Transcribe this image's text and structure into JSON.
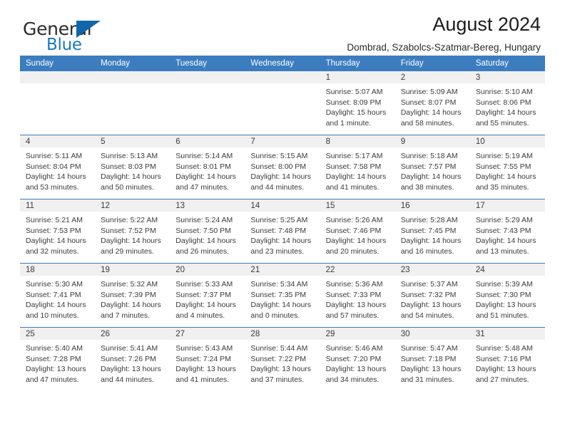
{
  "brand": {
    "name_top": "General",
    "name_bottom": "Blue",
    "logo_icon": "triangle-logo-icon",
    "accent_color": "#1878be"
  },
  "header": {
    "title": "August 2024",
    "location": "Dombrad, Szabolcs-Szatmar-Bereg, Hungary"
  },
  "colors": {
    "header_blue": "#3b7dbf",
    "daynum_band": "#f0f0f0",
    "text": "#3b3b3b"
  },
  "weekday_headers": [
    "Sunday",
    "Monday",
    "Tuesday",
    "Wednesday",
    "Thursday",
    "Friday",
    "Saturday"
  ],
  "weeks": [
    [
      {
        "day": "",
        "lines": []
      },
      {
        "day": "",
        "lines": []
      },
      {
        "day": "",
        "lines": []
      },
      {
        "day": "",
        "lines": []
      },
      {
        "day": "1",
        "lines": [
          "Sunrise: 5:07 AM",
          "Sunset: 8:09 PM",
          "Daylight: 15 hours",
          "and 1 minute."
        ]
      },
      {
        "day": "2",
        "lines": [
          "Sunrise: 5:09 AM",
          "Sunset: 8:07 PM",
          "Daylight: 14 hours",
          "and 58 minutes."
        ]
      },
      {
        "day": "3",
        "lines": [
          "Sunrise: 5:10 AM",
          "Sunset: 8:06 PM",
          "Daylight: 14 hours",
          "and 55 minutes."
        ]
      }
    ],
    [
      {
        "day": "4",
        "lines": [
          "Sunrise: 5:11 AM",
          "Sunset: 8:04 PM",
          "Daylight: 14 hours",
          "and 53 minutes."
        ]
      },
      {
        "day": "5",
        "lines": [
          "Sunrise: 5:13 AM",
          "Sunset: 8:03 PM",
          "Daylight: 14 hours",
          "and 50 minutes."
        ]
      },
      {
        "day": "6",
        "lines": [
          "Sunrise: 5:14 AM",
          "Sunset: 8:01 PM",
          "Daylight: 14 hours",
          "and 47 minutes."
        ]
      },
      {
        "day": "7",
        "lines": [
          "Sunrise: 5:15 AM",
          "Sunset: 8:00 PM",
          "Daylight: 14 hours",
          "and 44 minutes."
        ]
      },
      {
        "day": "8",
        "lines": [
          "Sunrise: 5:17 AM",
          "Sunset: 7:58 PM",
          "Daylight: 14 hours",
          "and 41 minutes."
        ]
      },
      {
        "day": "9",
        "lines": [
          "Sunrise: 5:18 AM",
          "Sunset: 7:57 PM",
          "Daylight: 14 hours",
          "and 38 minutes."
        ]
      },
      {
        "day": "10",
        "lines": [
          "Sunrise: 5:19 AM",
          "Sunset: 7:55 PM",
          "Daylight: 14 hours",
          "and 35 minutes."
        ]
      }
    ],
    [
      {
        "day": "11",
        "lines": [
          "Sunrise: 5:21 AM",
          "Sunset: 7:53 PM",
          "Daylight: 14 hours",
          "and 32 minutes."
        ]
      },
      {
        "day": "12",
        "lines": [
          "Sunrise: 5:22 AM",
          "Sunset: 7:52 PM",
          "Daylight: 14 hours",
          "and 29 minutes."
        ]
      },
      {
        "day": "13",
        "lines": [
          "Sunrise: 5:24 AM",
          "Sunset: 7:50 PM",
          "Daylight: 14 hours",
          "and 26 minutes."
        ]
      },
      {
        "day": "14",
        "lines": [
          "Sunrise: 5:25 AM",
          "Sunset: 7:48 PM",
          "Daylight: 14 hours",
          "and 23 minutes."
        ]
      },
      {
        "day": "15",
        "lines": [
          "Sunrise: 5:26 AM",
          "Sunset: 7:46 PM",
          "Daylight: 14 hours",
          "and 20 minutes."
        ]
      },
      {
        "day": "16",
        "lines": [
          "Sunrise: 5:28 AM",
          "Sunset: 7:45 PM",
          "Daylight: 14 hours",
          "and 16 minutes."
        ]
      },
      {
        "day": "17",
        "lines": [
          "Sunrise: 5:29 AM",
          "Sunset: 7:43 PM",
          "Daylight: 14 hours",
          "and 13 minutes."
        ]
      }
    ],
    [
      {
        "day": "18",
        "lines": [
          "Sunrise: 5:30 AM",
          "Sunset: 7:41 PM",
          "Daylight: 14 hours",
          "and 10 minutes."
        ]
      },
      {
        "day": "19",
        "lines": [
          "Sunrise: 5:32 AM",
          "Sunset: 7:39 PM",
          "Daylight: 14 hours",
          "and 7 minutes."
        ]
      },
      {
        "day": "20",
        "lines": [
          "Sunrise: 5:33 AM",
          "Sunset: 7:37 PM",
          "Daylight: 14 hours",
          "and 4 minutes."
        ]
      },
      {
        "day": "21",
        "lines": [
          "Sunrise: 5:34 AM",
          "Sunset: 7:35 PM",
          "Daylight: 14 hours",
          "and 0 minutes."
        ]
      },
      {
        "day": "22",
        "lines": [
          "Sunrise: 5:36 AM",
          "Sunset: 7:33 PM",
          "Daylight: 13 hours",
          "and 57 minutes."
        ]
      },
      {
        "day": "23",
        "lines": [
          "Sunrise: 5:37 AM",
          "Sunset: 7:32 PM",
          "Daylight: 13 hours",
          "and 54 minutes."
        ]
      },
      {
        "day": "24",
        "lines": [
          "Sunrise: 5:39 AM",
          "Sunset: 7:30 PM",
          "Daylight: 13 hours",
          "and 51 minutes."
        ]
      }
    ],
    [
      {
        "day": "25",
        "lines": [
          "Sunrise: 5:40 AM",
          "Sunset: 7:28 PM",
          "Daylight: 13 hours",
          "and 47 minutes."
        ]
      },
      {
        "day": "26",
        "lines": [
          "Sunrise: 5:41 AM",
          "Sunset: 7:26 PM",
          "Daylight: 13 hours",
          "and 44 minutes."
        ]
      },
      {
        "day": "27",
        "lines": [
          "Sunrise: 5:43 AM",
          "Sunset: 7:24 PM",
          "Daylight: 13 hours",
          "and 41 minutes."
        ]
      },
      {
        "day": "28",
        "lines": [
          "Sunrise: 5:44 AM",
          "Sunset: 7:22 PM",
          "Daylight: 13 hours",
          "and 37 minutes."
        ]
      },
      {
        "day": "29",
        "lines": [
          "Sunrise: 5:46 AM",
          "Sunset: 7:20 PM",
          "Daylight: 13 hours",
          "and 34 minutes."
        ]
      },
      {
        "day": "30",
        "lines": [
          "Sunrise: 5:47 AM",
          "Sunset: 7:18 PM",
          "Daylight: 13 hours",
          "and 31 minutes."
        ]
      },
      {
        "day": "31",
        "lines": [
          "Sunrise: 5:48 AM",
          "Sunset: 7:16 PM",
          "Daylight: 13 hours",
          "and 27 minutes."
        ]
      }
    ]
  ]
}
